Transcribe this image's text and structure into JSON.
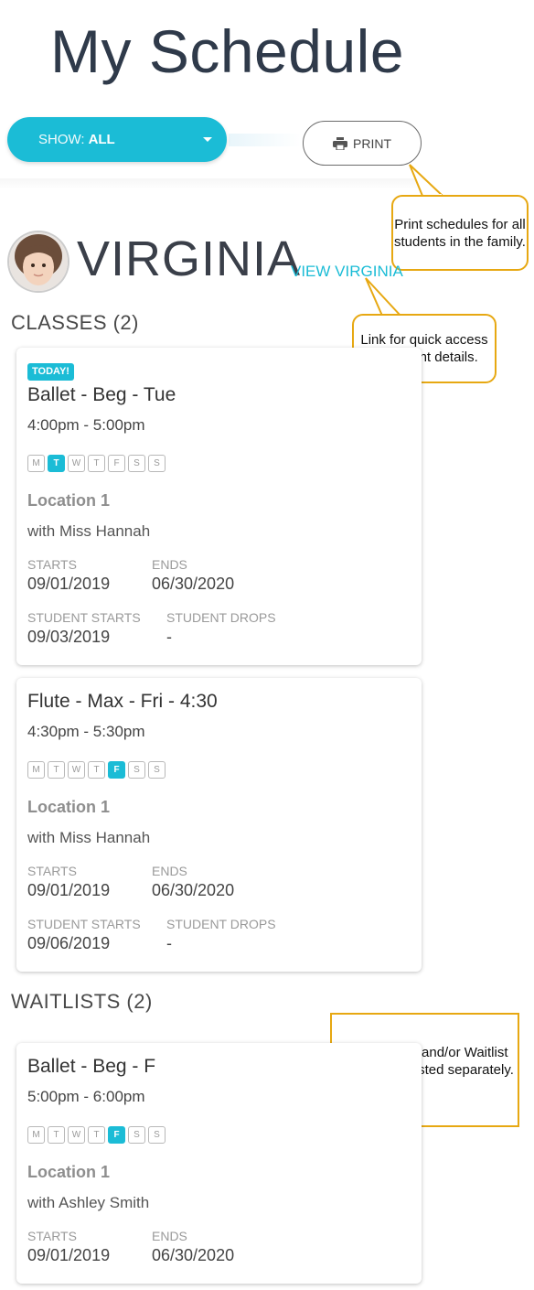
{
  "header": {
    "title": "My Schedule"
  },
  "toolbar": {
    "show_label": "SHOW:",
    "show_value": "ALL",
    "print_label": "PRINT"
  },
  "callouts": {
    "print": "Print schedules for all students in the family.",
    "view": "Link for quick access to student details.",
    "waitlist": "Any Makeup and/or Waitlist Classes are listed separately."
  },
  "student": {
    "name": "VIRGINIA",
    "view_link": "VIEW VIRGINIA"
  },
  "sections": {
    "classes": "CLASSES (2)",
    "waitlists": "WAITLISTS (2)"
  },
  "labels": {
    "starts": "STARTS",
    "ends": "ENDS",
    "student_starts": "STUDENT STARTS",
    "student_drops": "STUDENT DROPS"
  },
  "day_letters": [
    "M",
    "T",
    "W",
    "T",
    "F",
    "S",
    "S"
  ],
  "classes": [
    {
      "badge": "TODAY!",
      "name": "Ballet - Beg - Tue",
      "time": "4:00pm - 5:00pm",
      "active_day": 1,
      "location": "Location 1",
      "instructor": "with Miss Hannah",
      "starts": "09/01/2019",
      "ends": "06/30/2020",
      "student_starts": "09/03/2019",
      "student_drops": "-"
    },
    {
      "name": "Flute - Max - Fri - 4:30",
      "time": "4:30pm - 5:30pm",
      "active_day": 4,
      "location": "Location 1",
      "instructor": "with Miss Hannah",
      "starts": "09/01/2019",
      "ends": "06/30/2020",
      "student_starts": "09/06/2019",
      "student_drops": "-"
    }
  ],
  "waitlists": [
    {
      "name": "Ballet - Beg - F",
      "time": "5:00pm - 6:00pm",
      "active_day": 4,
      "location": "Location 1",
      "instructor": "with Ashley Smith",
      "starts": "09/01/2019",
      "ends": "06/30/2020"
    }
  ],
  "colors": {
    "accent": "#1bbcd6",
    "callout": "#e7a812"
  }
}
